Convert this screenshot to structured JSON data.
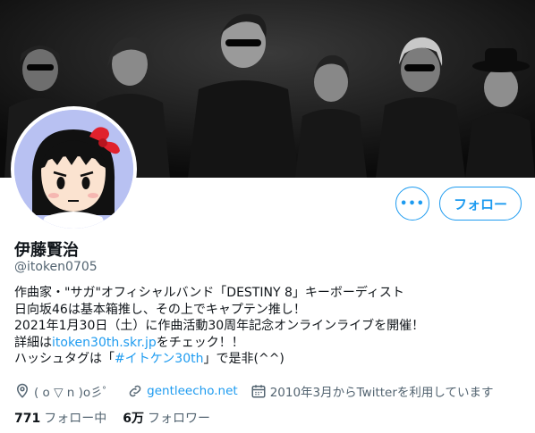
{
  "profile": {
    "display_name": "伊藤賢治",
    "handle": "@itoken0705",
    "bio_lines": [
      "作曲家・\"サガ\"オフィシャルバンド「DESTINY 8」キーボーディスト",
      "日向坂46は基本箱推し、その上でキャプテン推し！",
      "2021年1月30日（土）に作曲活動30周年記念オンラインライブを開催！"
    ],
    "bio_line4_prefix": "詳細は",
    "bio_line4_link": "itoken30th.skr.jp",
    "bio_line4_suffix": "をチェック！！",
    "bio_line5_prefix": "ハッシュタグは「",
    "bio_line5_hashtag": "#イトケン30th",
    "bio_line5_suffix": "」で是非(^^)",
    "location": "( o ▽ n )o彡゜",
    "website": "gentleecho.net",
    "joined": "2010年3月からTwitterを利用しています"
  },
  "actions": {
    "more_label": "•••",
    "follow_label": "フォロー"
  },
  "stats": {
    "following_count": "771",
    "following_label": "フォロー中",
    "followers_count": "6万",
    "followers_label": "フォロワー"
  },
  "colors": {
    "accent": "#1d9bf0",
    "secondary_text": "#536471",
    "primary_text": "#0f1419",
    "avatar_bg": "#b8c1f2"
  },
  "icons": {
    "location": "location-pin-icon",
    "website": "link-icon",
    "joined": "calendar-icon"
  }
}
